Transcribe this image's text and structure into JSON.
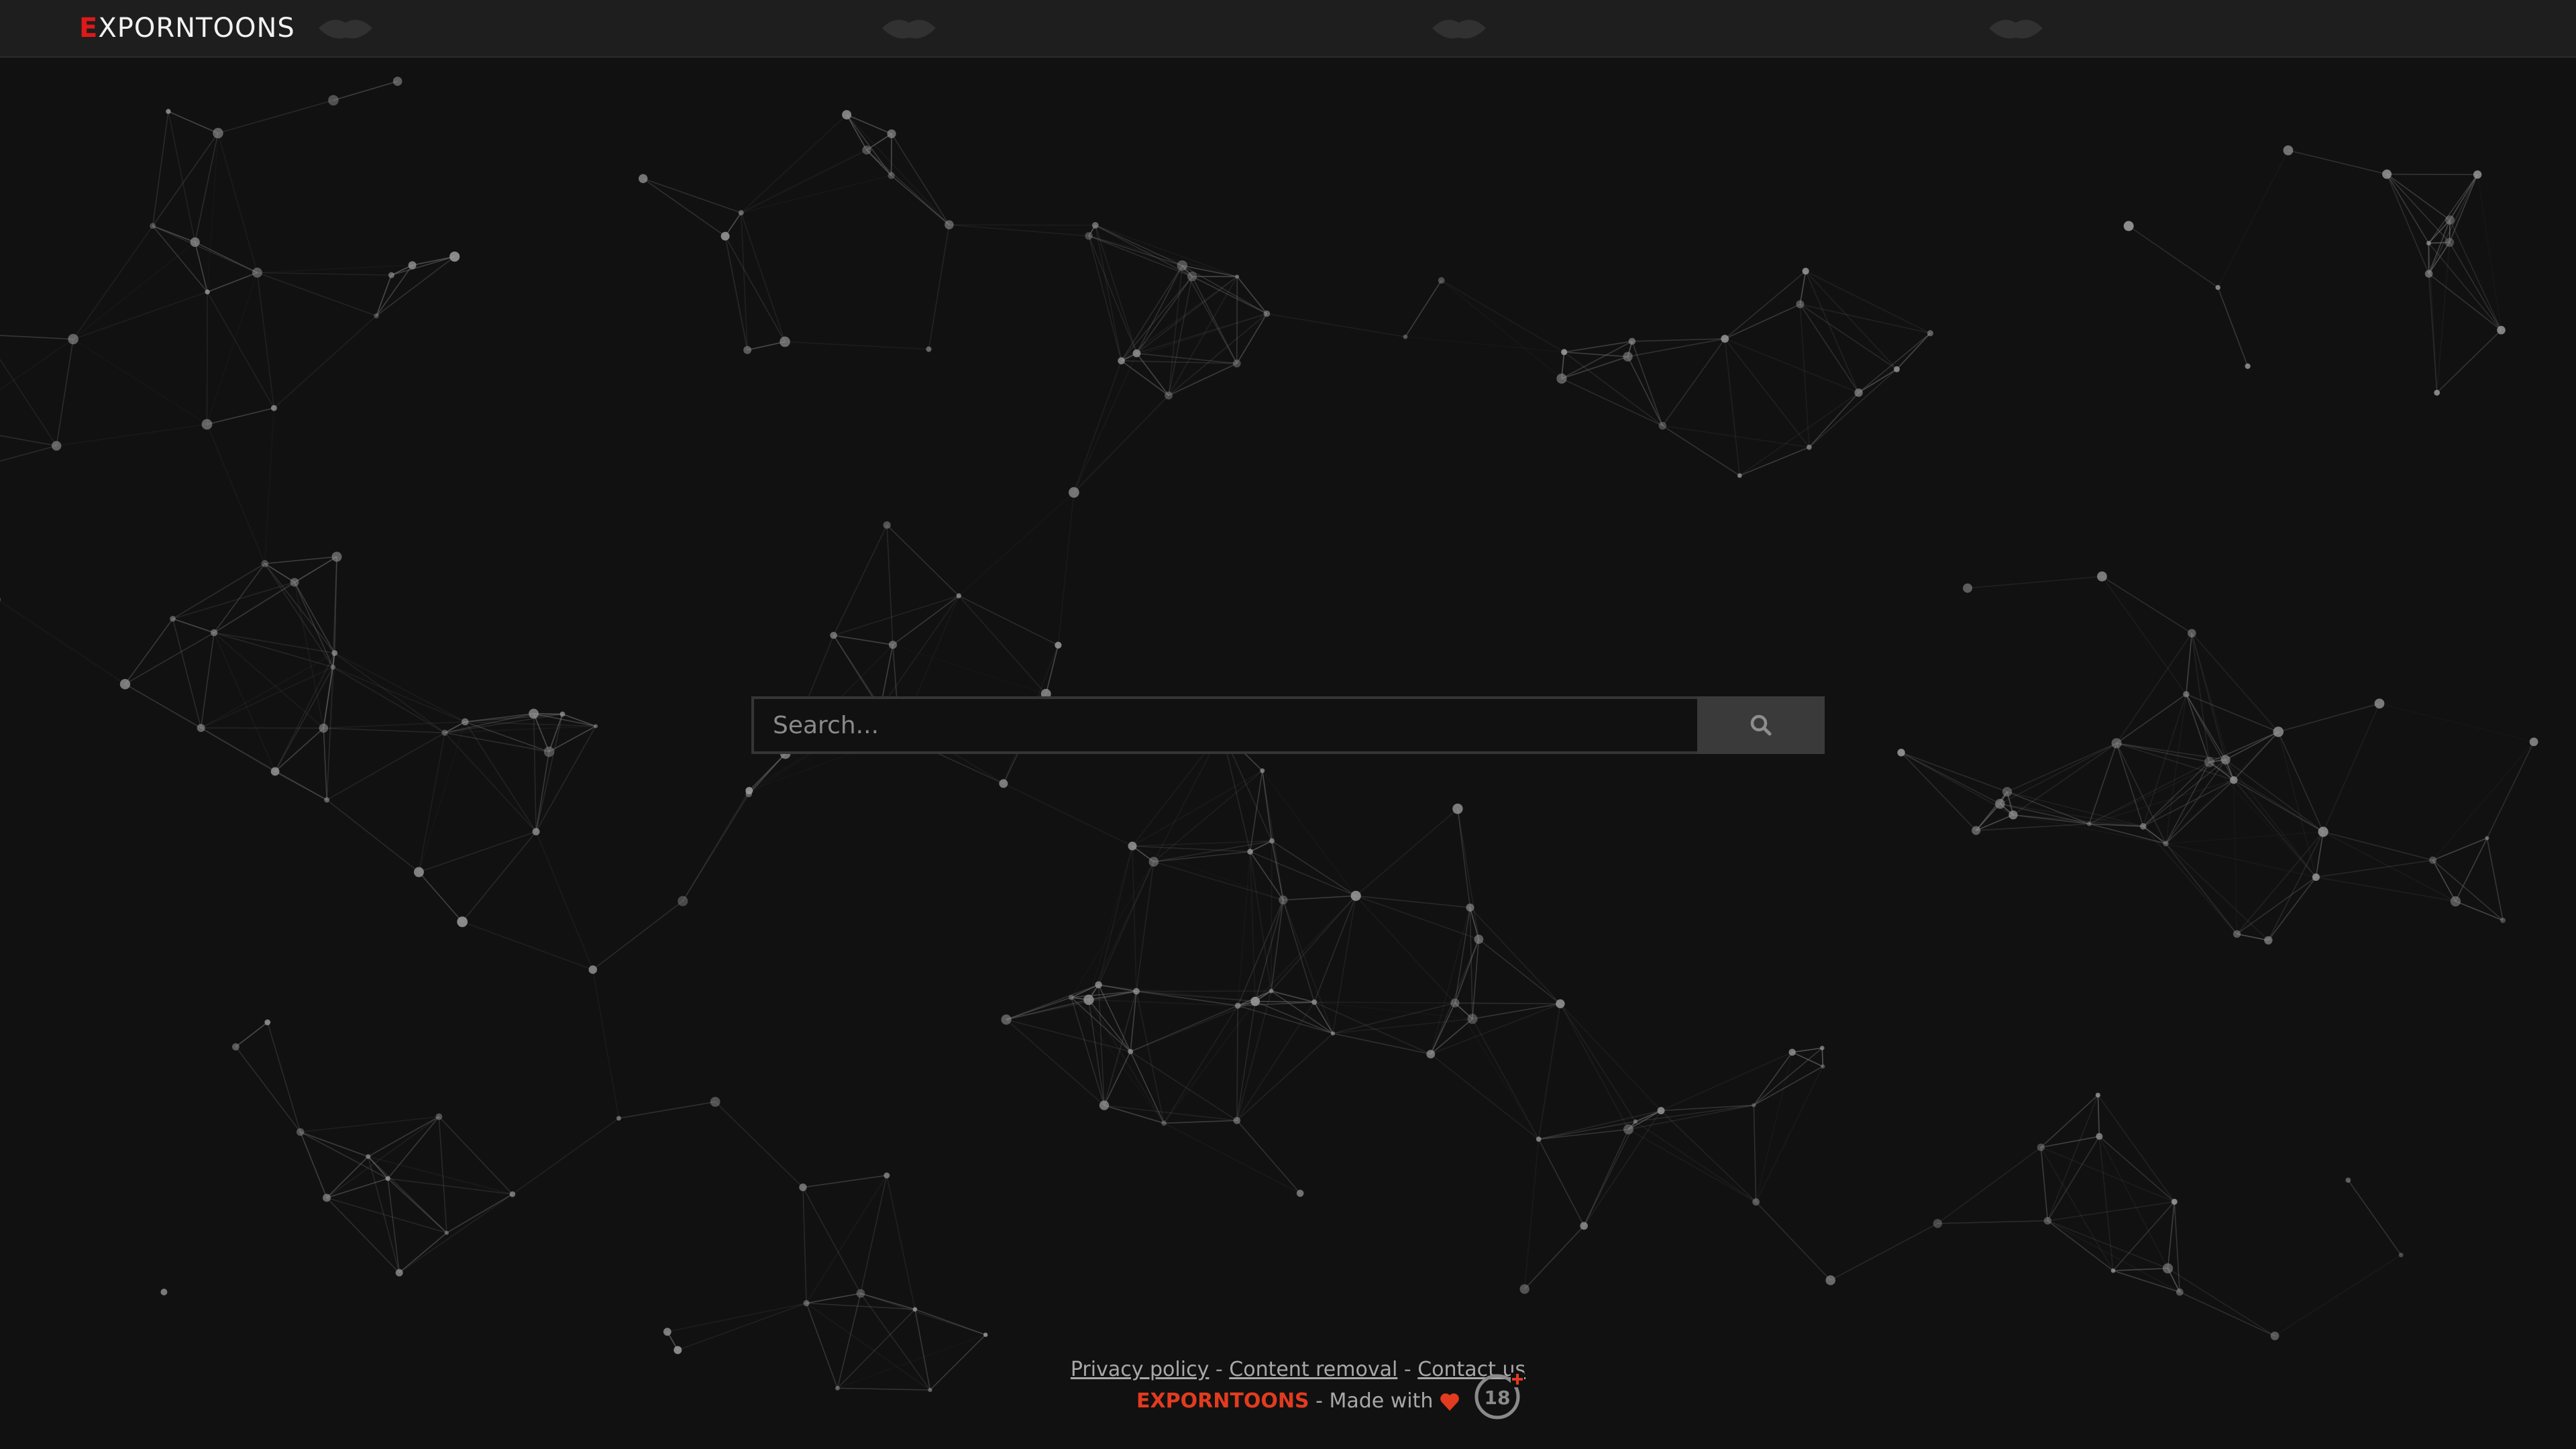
{
  "header": {
    "logo_first_letter": "E",
    "logo_rest": "XPORNTOONS"
  },
  "search": {
    "placeholder": "Search...",
    "button_icon": "search-icon"
  },
  "footer": {
    "links": [
      {
        "label": "Privacy policy"
      },
      {
        "label": "Content removal"
      },
      {
        "label": "Contact us"
      }
    ],
    "separator": "-",
    "brand": "EXPORNTOONS",
    "made_with": "- Made with",
    "heart_icon": "heart-icon",
    "age_badge_icon": "18-plus-icon",
    "age_badge_text": "18"
  },
  "colors": {
    "background": "#111111",
    "accent_red": "#e01818",
    "footer_brand": "#e23b1f",
    "network_line": "#6a6a6a"
  }
}
